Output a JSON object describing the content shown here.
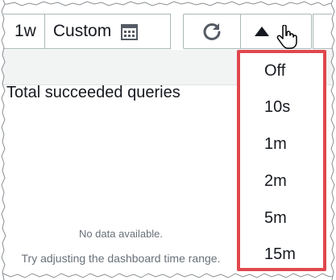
{
  "toolbar": {
    "range_1w": "1w",
    "range_custom": "Custom"
  },
  "widget": {
    "title": "Total succeeded queries",
    "empty_title": "No data available.",
    "empty_hint": "Try adjusting the dashboard time range."
  },
  "refresh_menu": {
    "items": [
      "Off",
      "10s",
      "1m",
      "2m",
      "5m",
      "15m"
    ]
  },
  "colors": {
    "highlight": "#e0474c",
    "border": "#aab7b8",
    "muted_text": "#687078"
  }
}
